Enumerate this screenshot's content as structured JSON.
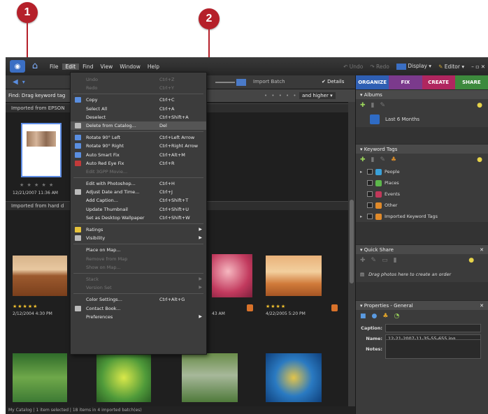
{
  "callouts": [
    "1",
    "2"
  ],
  "menubar": {
    "items": [
      "File",
      "Edit",
      "Find",
      "View",
      "Window",
      "Help"
    ],
    "undo": "Undo",
    "redo": "Redo",
    "display": "Display",
    "editor": "Editor"
  },
  "toolbar": {
    "import_batch": "Import Batch",
    "details": "Details"
  },
  "findbar": {
    "text": "Find: Drag keyword tag",
    "rating_filter": "and higher"
  },
  "groups": [
    {
      "title": "Imported from EPSON"
    },
    {
      "title": "Imported from hard d"
    }
  ],
  "photos": [
    {
      "date": "12/21/2007 11:36 AM",
      "stars": "★ ★ ★ ★ ★"
    },
    {
      "date": "2/12/2004 4:30 PM",
      "stars": "★★★★★"
    },
    {
      "date": "43 AM",
      "stars": ""
    },
    {
      "date": "4/22/2005 5:20 PM",
      "stars": "★★★★"
    }
  ],
  "statusbar": {
    "text": "My Catalog  |  1 item selected  |  18 items in 4 imported batch(es)"
  },
  "tabs": [
    {
      "label": "ORGANIZE",
      "color": "#2f5fb3"
    },
    {
      "label": "FIX",
      "color": "#7b3a8c"
    },
    {
      "label": "CREATE",
      "color": "#b0265f"
    },
    {
      "label": "SHARE",
      "color": "#3d8a3d"
    }
  ],
  "panel": {
    "albums_title": "Albums",
    "album_item": "Last 6 Months",
    "keyword_title": "Keyword Tags",
    "tags": [
      {
        "label": "People",
        "color": "#3aa0d9"
      },
      {
        "label": "Places",
        "color": "#5db84b"
      },
      {
        "label": "Events",
        "color": "#c2385a"
      },
      {
        "label": "Other",
        "color": "#e08a2a"
      },
      {
        "label": "Imported Keyword Tags",
        "color": "#e08a2a"
      }
    ],
    "quick_share_title": "Quick Share",
    "quick_share_hint": "Drag photos here to create an order",
    "properties_title": "Properties - General",
    "caption_label": "Caption:",
    "name_label": "Name:",
    "name_value": "12-21-2007-11-35-55-655.jpg",
    "notes_label": "Notes:"
  },
  "edit_menu": [
    {
      "label": "Undo",
      "shortcut": "Ctrl+Z",
      "disabled": true
    },
    {
      "label": "Redo",
      "shortcut": "Ctrl+Y",
      "disabled": true
    },
    {
      "sep": true
    },
    {
      "label": "Copy",
      "shortcut": "Ctrl+C",
      "icon": "copy-icon"
    },
    {
      "label": "Select All",
      "shortcut": "Ctrl+A"
    },
    {
      "label": "Deselect",
      "shortcut": "Ctrl+Shift+A"
    },
    {
      "label": "Delete from Catalog...",
      "shortcut": "Del",
      "icon": "delete-icon",
      "highlight": true
    },
    {
      "sep": true
    },
    {
      "label": "Rotate 90° Left",
      "shortcut": "Ctrl+Left Arrow",
      "icon": "rotate-left-icon"
    },
    {
      "label": "Rotate 90° Right",
      "shortcut": "Ctrl+Right Arrow",
      "icon": "rotate-right-icon"
    },
    {
      "label": "Auto Smart Fix",
      "shortcut": "Ctrl+Alt+M",
      "icon": "smart-fix-icon"
    },
    {
      "label": "Auto Red Eye Fix",
      "shortcut": "Ctrl+R",
      "icon": "red-eye-icon"
    },
    {
      "label": "Edit 3GPP Movie...",
      "shortcut": "",
      "disabled": true
    },
    {
      "sep": true
    },
    {
      "label": "Edit with Photoshop...",
      "shortcut": "Ctrl+H"
    },
    {
      "label": "Adjust Date and Time...",
      "shortcut": "Ctrl+J",
      "icon": "date-icon"
    },
    {
      "label": "Add Caption...",
      "shortcut": "Ctrl+Shift+T"
    },
    {
      "label": "Update Thumbnail",
      "shortcut": "Ctrl+Shift+U"
    },
    {
      "label": "Set as Desktop Wallpaper",
      "shortcut": "Ctrl+Shift+W"
    },
    {
      "sep": true
    },
    {
      "label": "Ratings",
      "shortcut": "",
      "icon": "star-icon",
      "submenu": true
    },
    {
      "label": "Visibility",
      "shortcut": "",
      "icon": "visibility-icon",
      "submenu": true
    },
    {
      "sep": true
    },
    {
      "label": "Place on Map...",
      "shortcut": ""
    },
    {
      "label": "Remove from Map",
      "shortcut": "",
      "disabled": true
    },
    {
      "label": "Show on Map...",
      "shortcut": "",
      "disabled": true
    },
    {
      "sep": true
    },
    {
      "label": "Stack",
      "shortcut": "",
      "disabled": true,
      "submenu": true
    },
    {
      "label": "Version Set",
      "shortcut": "",
      "disabled": true,
      "submenu": true
    },
    {
      "sep": true
    },
    {
      "label": "Color Settings...",
      "shortcut": "Ctrl+Alt+G"
    },
    {
      "label": "Contact Book...",
      "shortcut": "",
      "icon": "contact-icon"
    },
    {
      "label": "Preferences",
      "shortcut": "",
      "submenu": true
    }
  ]
}
